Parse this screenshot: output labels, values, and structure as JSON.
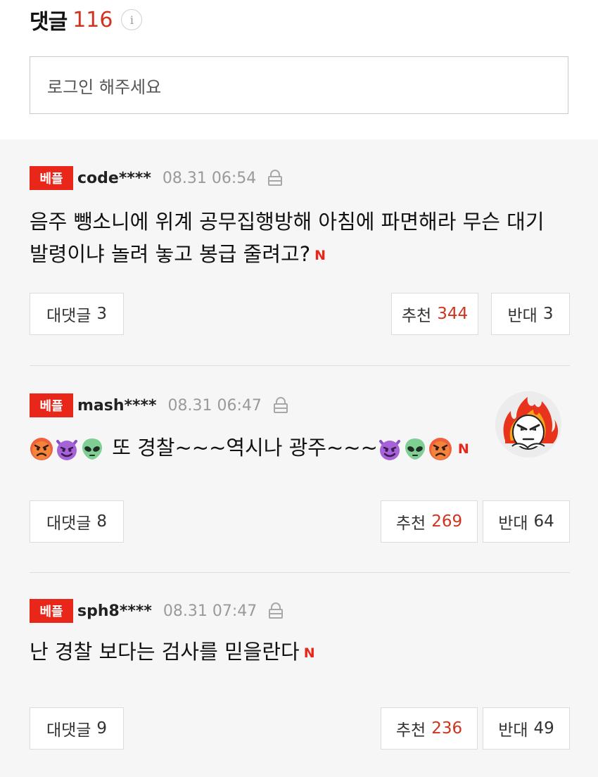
{
  "header": {
    "title": "댓글",
    "count": "116",
    "info_glyph": "i"
  },
  "login": {
    "placeholder": "로그인 해주세요"
  },
  "comments": [
    {
      "badge": "베플",
      "user": "code****",
      "time": "08.31 06:54",
      "text": "음주 뺑소니에 위계 공무집행방해 아침에 파면해라 무슨 대기 발령이냐 놀려 놓고 봉급 줄려고?",
      "new_mark": "N",
      "reply_label": "대댓글",
      "reply_count": "3",
      "like_label": "추천",
      "like_count": "344",
      "dislike_label": "반대",
      "dislike_count": "3"
    },
    {
      "badge": "베플",
      "user": "mash****",
      "time": "08.31 06:47",
      "text": "또 경찰~~~역시나 광주~~~",
      "new_mark": "N",
      "reply_label": "대댓글",
      "reply_count": "8",
      "like_label": "추천",
      "like_count": "269",
      "dislike_label": "반대",
      "dislike_count": "64",
      "emojis_before": [
        "angry-face-icon",
        "smiling-devil-icon",
        "alien-icon"
      ],
      "emojis_after": [
        "smiling-devil-icon",
        "alien-icon",
        "angry-face-icon"
      ]
    },
    {
      "badge": "베플",
      "user": "sph8****",
      "time": "08.31 07:47",
      "text": "난 경찰 보다는 검사를 믿을란다",
      "new_mark": "N",
      "reply_label": "대댓글",
      "reply_count": "9",
      "like_label": "추천",
      "like_count": "236",
      "dislike_label": "반대",
      "dislike_count": "49"
    }
  ],
  "colors": {
    "accent": "#e8261a",
    "count_red": "#d0341f",
    "list_bg": "#f6f6f6"
  }
}
